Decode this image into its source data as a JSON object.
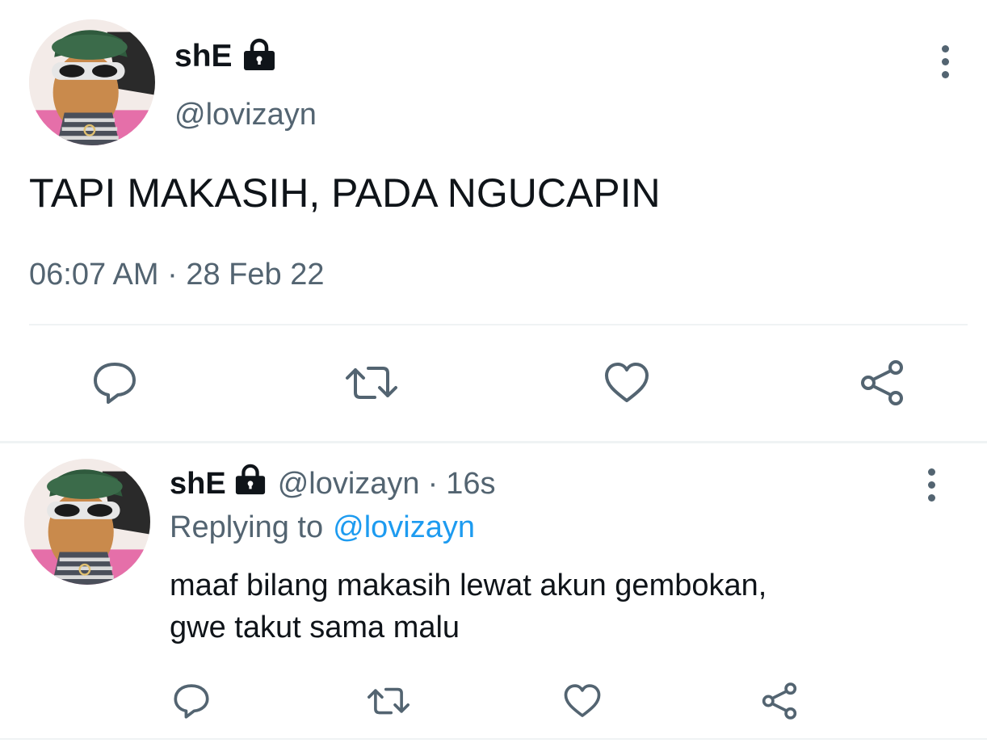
{
  "main_tweet": {
    "display_name": "shE",
    "handle": "@lovizayn",
    "text": "TAPI MAKASIH, PADA NGUCAPIN",
    "time": "06:07 AM",
    "separator": "·",
    "date": "28 Feb 22",
    "protected_icon": "lock-icon",
    "more_icon": "more-vertical-icon"
  },
  "actions": {
    "reply_icon": "reply-icon",
    "retweet_icon": "retweet-icon",
    "like_icon": "heart-icon",
    "share_icon": "share-icon"
  },
  "reply_tweet": {
    "display_name": "shE",
    "handle": "@lovizayn",
    "separator": "·",
    "relative_time": "16s",
    "replying_to_label": "Replying to",
    "replying_to_handle": "@lovizayn",
    "text_line1": "maaf bilang makasih lewat akun gembokan,",
    "text_line2": "gwe takut sama malu"
  },
  "colors": {
    "text_primary": "#0f1419",
    "text_secondary": "#536471",
    "link": "#1d9bf0",
    "divider": "#eff3f4",
    "icon": "#536471"
  }
}
